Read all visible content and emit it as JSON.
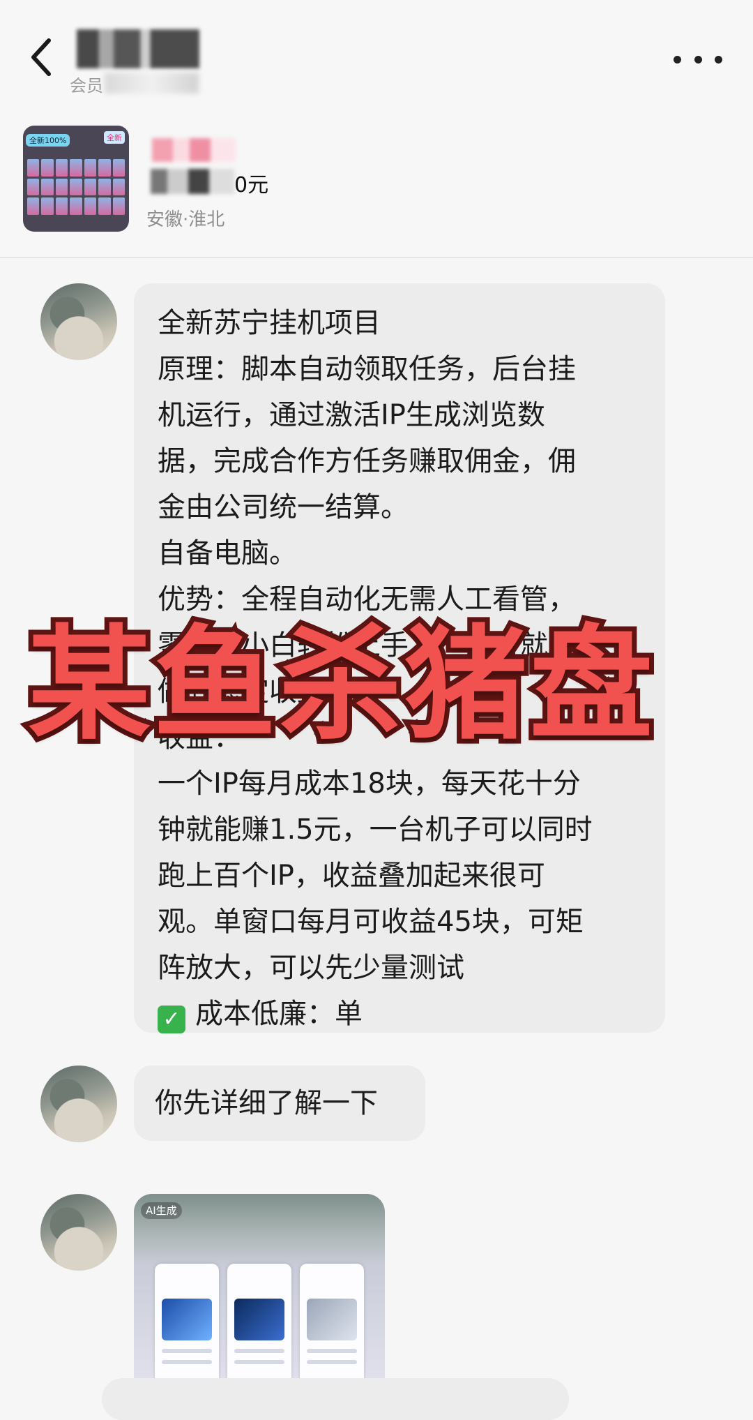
{
  "header": {
    "member_label": "会员",
    "back_icon": "chevron-left-icon",
    "more_icon": "more-horizontal-icon"
  },
  "product": {
    "thumb_badge": "全新100%",
    "thumb_badge2": "全新",
    "price_suffix": "0元",
    "location": "安徽·淮北"
  },
  "messages": {
    "main_lines": [
      "全新苏宁挂机项目",
      "原理：脚本自动领取任务，后台挂",
      "机运行，通过激活IP生成浏览数",
      "据，完成合作方任务赚取佣金，佣",
      "金由公司统一结算。",
      "自备电脑。",
      "优势：全程自动化无需人工看管，",
      "零基础小白轻松上手，一个月就能",
      "做到稳定收益。",
      "收益：",
      "一个IP每月成本18块，每天花十分",
      "钟就能赚1.5元，一台机子可以同时",
      "跑上百个IP，收益叠加起来很可",
      "观。单窗口每月可收益45块，可矩",
      "阵放大，可以先少量测试"
    ],
    "check_line": "成本低廉：单",
    "check_icon": "check-mark-icon",
    "short_reply": "你先详细了解一下",
    "image_tag": "AI生成"
  },
  "watermark": {
    "text": "某鱼杀猪盘",
    "color": "#f2524f"
  }
}
